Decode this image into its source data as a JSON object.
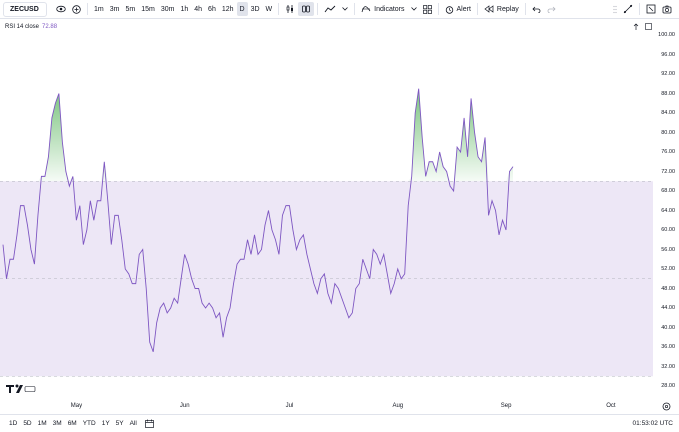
{
  "toolbar": {
    "symbol": "ZECUSD",
    "intervals": [
      "1m",
      "3m",
      "5m",
      "15m",
      "30m",
      "1h",
      "4h",
      "6h",
      "12h",
      "D",
      "3D",
      "W"
    ],
    "active_interval": "D",
    "indicators_label": "Indicators",
    "alert_label": "Alert",
    "replay_label": "Replay"
  },
  "legend": {
    "name": "RSI 14 close",
    "value": "72.88"
  },
  "price_axis": {
    "ticks": [
      "100.00",
      "96.00",
      "92.00",
      "88.00",
      "84.00",
      "80.00",
      "76.00",
      "72.00",
      "68.00",
      "64.00",
      "60.00",
      "56.00",
      "52.00",
      "48.00",
      "44.00",
      "40.00",
      "36.00",
      "32.00",
      "28.00"
    ]
  },
  "time_axis": {
    "ticks": [
      "May",
      "Jun",
      "Jul",
      "Aug",
      "Sep",
      "Oct"
    ]
  },
  "bottom_bar": {
    "ranges": [
      "1D",
      "5D",
      "1M",
      "3M",
      "6M",
      "YTD",
      "1Y",
      "5Y",
      "All"
    ],
    "clock": "01:53:02 UTC"
  },
  "logo_text": "TV",
  "colors": {
    "rsi_line": "#7e57c2",
    "band_fill": "#ede7f6",
    "overbought_fill": "#4caf50",
    "band_line": "#b2b5be"
  },
  "chart_data": {
    "type": "line",
    "title": "RSI 14 close",
    "ylim": [
      28,
      100
    ],
    "upper_band": 70,
    "middle_band": 50,
    "lower_band": 30,
    "x": [
      "2025-04-20",
      "2025-04-21",
      "2025-04-22",
      "2025-04-23",
      "2025-04-24",
      "2025-04-25",
      "2025-04-26",
      "2025-04-27",
      "2025-04-28",
      "2025-04-29",
      "2025-04-30",
      "2025-05-01",
      "2025-05-02",
      "2025-05-03",
      "2025-05-04",
      "2025-05-05",
      "2025-05-06",
      "2025-05-07",
      "2025-05-08",
      "2025-05-09",
      "2025-05-10",
      "2025-05-11",
      "2025-05-12",
      "2025-05-13",
      "2025-05-14",
      "2025-05-15",
      "2025-05-16",
      "2025-05-17",
      "2025-05-18",
      "2025-05-19",
      "2025-05-20",
      "2025-05-21",
      "2025-05-22",
      "2025-05-23",
      "2025-05-24",
      "2025-05-25",
      "2025-05-26",
      "2025-05-27",
      "2025-05-28",
      "2025-05-29",
      "2025-05-30",
      "2025-05-31",
      "2025-06-01",
      "2025-06-02",
      "2025-06-03",
      "2025-06-04",
      "2025-06-05",
      "2025-06-06",
      "2025-06-07",
      "2025-06-08",
      "2025-06-09",
      "2025-06-10",
      "2025-06-11",
      "2025-06-12",
      "2025-06-13",
      "2025-06-14",
      "2025-06-15",
      "2025-06-16",
      "2025-06-17",
      "2025-06-18",
      "2025-06-19",
      "2025-06-20",
      "2025-06-21",
      "2025-06-22",
      "2025-06-23",
      "2025-06-24",
      "2025-06-25",
      "2025-06-26",
      "2025-06-27",
      "2025-06-28",
      "2025-06-29",
      "2025-06-30",
      "2025-07-01",
      "2025-07-02",
      "2025-07-03",
      "2025-07-04",
      "2025-07-05",
      "2025-07-06",
      "2025-07-07",
      "2025-07-08",
      "2025-07-09",
      "2025-07-10",
      "2025-07-11",
      "2025-07-12",
      "2025-07-13",
      "2025-07-14",
      "2025-07-15",
      "2025-07-16",
      "2025-07-17",
      "2025-07-18",
      "2025-07-19",
      "2025-07-20",
      "2025-07-21",
      "2025-07-22",
      "2025-07-23",
      "2025-07-24",
      "2025-07-25",
      "2025-07-26",
      "2025-07-27",
      "2025-07-28",
      "2025-07-29",
      "2025-07-30",
      "2025-07-31",
      "2025-08-01",
      "2025-08-02",
      "2025-08-03",
      "2025-08-04",
      "2025-08-05",
      "2025-08-06",
      "2025-08-07",
      "2025-08-08",
      "2025-08-09",
      "2025-08-10",
      "2025-08-11",
      "2025-08-12",
      "2025-08-13",
      "2025-08-14",
      "2025-08-15",
      "2025-08-16",
      "2025-08-17",
      "2025-08-18",
      "2025-08-19",
      "2025-08-20",
      "2025-08-21",
      "2025-08-22",
      "2025-08-23",
      "2025-08-24",
      "2025-08-25",
      "2025-08-26",
      "2025-08-27",
      "2025-08-28",
      "2025-08-29",
      "2025-08-30",
      "2025-08-31",
      "2025-09-01",
      "2025-09-02",
      "2025-09-03",
      "2025-09-04",
      "2025-09-05",
      "2025-09-06",
      "2025-09-07",
      "2025-09-08",
      "2025-09-09",
      "2025-09-10",
      "2025-09-11",
      "2025-09-12",
      "2025-09-13",
      "2025-09-14",
      "2025-09-15",
      "2025-09-16"
    ],
    "values": [
      57,
      50,
      54,
      54,
      59,
      65,
      65,
      61,
      56,
      53,
      63,
      71,
      71,
      75,
      83,
      86,
      88,
      78,
      72,
      69,
      71,
      62,
      65,
      57,
      60,
      66,
      62,
      66,
      66,
      74,
      66,
      57,
      63,
      63,
      58,
      52,
      51,
      49,
      49,
      55,
      56,
      48,
      37,
      35,
      41,
      44,
      45,
      43,
      44,
      46,
      45,
      50,
      55,
      53,
      50,
      48,
      48,
      45,
      44,
      45,
      44,
      42,
      43,
      38,
      42,
      44,
      49,
      53,
      54,
      54,
      58,
      55,
      59,
      55,
      56,
      61,
      64,
      60,
      58,
      55,
      63,
      65,
      65,
      60,
      56,
      58,
      59,
      55,
      52,
      49,
      47,
      50,
      51,
      47,
      45,
      49,
      48,
      46,
      44,
      42,
      43,
      48,
      49,
      54,
      52,
      50,
      56,
      55,
      53,
      55,
      51,
      47,
      49,
      52,
      50,
      51,
      65,
      71,
      84,
      89,
      79,
      71,
      74,
      74,
      72,
      76,
      73,
      72,
      69,
      68,
      77,
      76,
      83,
      75,
      87,
      80,
      75,
      74,
      79,
      63,
      66,
      64,
      59,
      62,
      60,
      72,
      73
    ]
  }
}
